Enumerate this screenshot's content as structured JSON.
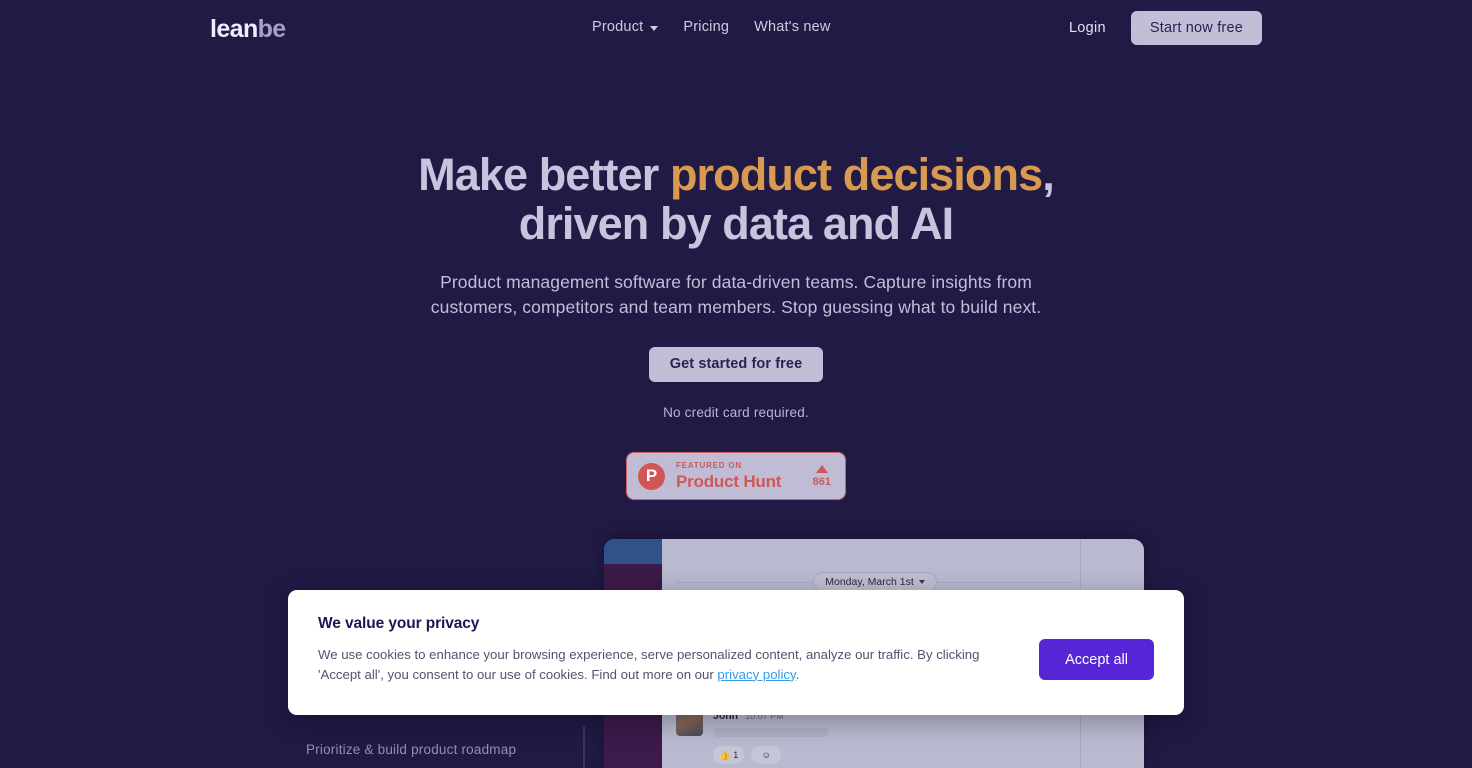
{
  "header": {
    "logo_primary": "lean",
    "logo_secondary": "be",
    "nav": [
      {
        "label": "Product",
        "has_caret": true
      },
      {
        "label": "Pricing",
        "has_caret": false
      },
      {
        "label": "What's new",
        "has_caret": false
      }
    ],
    "login_label": "Login",
    "start_label": "Start now free"
  },
  "hero": {
    "headline_part1": "Make better ",
    "headline_accent": "product decisions",
    "headline_part2": ",",
    "headline_line2": "driven by data and AI",
    "accent_color": "#d79a50",
    "subtitle_line1": "Product management software for data-driven teams. Capture insights from",
    "subtitle_line2": "customers, competitors and team members. Stop guessing what to build next.",
    "cta_label": "Get started for free",
    "no_credit_card": "No credit card required."
  },
  "product_hunt": {
    "icon": "product-hunt-p-icon",
    "icon_letter": "P",
    "featured_label": "FEATURED ON",
    "name": "Product Hunt",
    "upvote_icon": "upvote-triangle-icon",
    "upvote_count": "861",
    "brand_color": "#d05654",
    "background_color": "#c0bcd5"
  },
  "mockup": {
    "date_pill": "Monday, March 1st",
    "date_caret_icon": "chevron-down-icon",
    "message": {
      "author": "John",
      "time": "10:07 PM",
      "reaction_emoji": "👍",
      "reaction_count": "1",
      "add_reaction_icon": "add-emoji-icon"
    }
  },
  "left_caption": "Prioritize & build product roadmap",
  "cookie_banner": {
    "title": "We value your privacy",
    "body_part1": "We use cookies to enhance your browsing experience, serve personalized content, analyze our traffic. By clicking 'Accept all', you consent to our use of cookies. Find out more on our ",
    "link_text": "privacy policy",
    "body_part2": ".",
    "accept_label": "Accept all",
    "accept_color": "#5626d6",
    "link_color": "#2f9ce8"
  }
}
